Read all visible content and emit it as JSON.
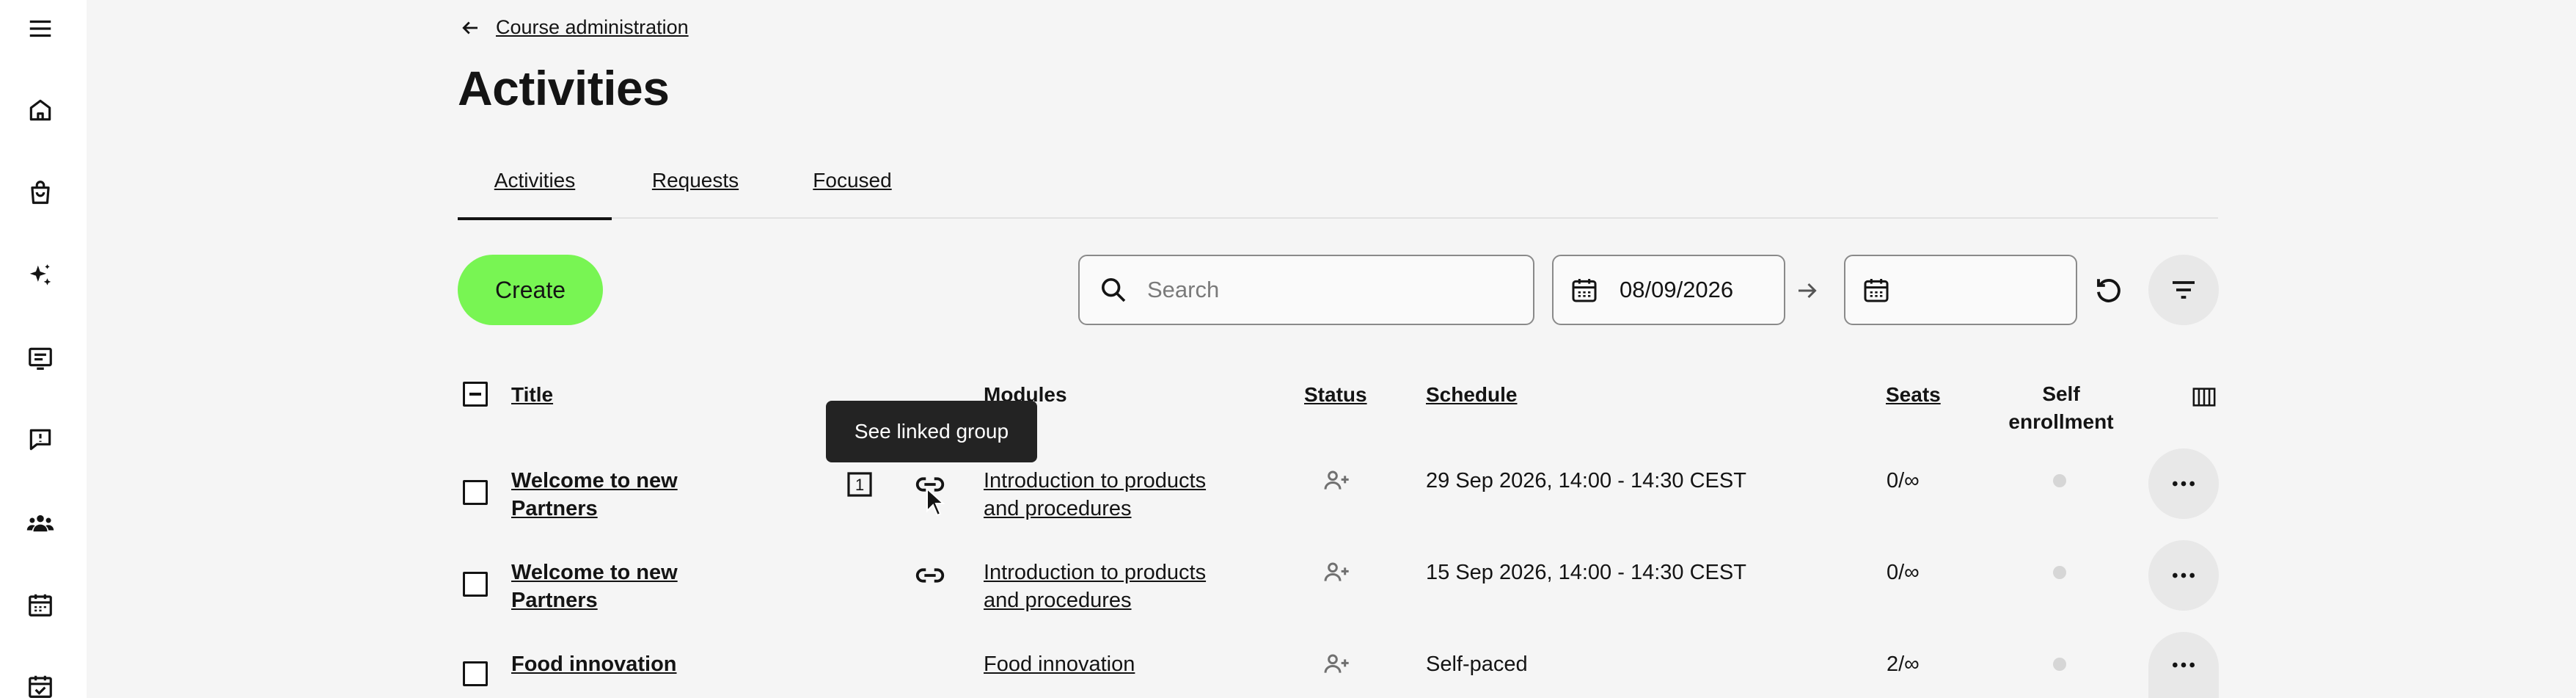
{
  "sidebar": {
    "items": [
      {
        "icon": "menu-icon"
      },
      {
        "icon": "home-icon"
      },
      {
        "icon": "shopping-bag-icon"
      },
      {
        "icon": "sparkles-icon"
      },
      {
        "icon": "document-list-icon"
      },
      {
        "icon": "feedback-icon"
      },
      {
        "icon": "users-icon"
      },
      {
        "icon": "calendar-icon"
      },
      {
        "icon": "calendar-check-icon"
      }
    ]
  },
  "header": {
    "back_label": "Course administration",
    "title": "Activities"
  },
  "tabs": [
    {
      "label": "Activities",
      "active": true
    },
    {
      "label": "Requests",
      "active": false
    },
    {
      "label": "Focused",
      "active": false
    }
  ],
  "toolbar": {
    "create_label": "Create",
    "search_placeholder": "Search",
    "date_from": "08/09/2026",
    "date_to": ""
  },
  "table": {
    "columns": {
      "title": "Title",
      "modules": "Modules",
      "status": "Status",
      "schedule": "Schedule",
      "seats": "Seats",
      "self_enrollment_line1": "Self",
      "self_enrollment_line2": "enrollment"
    },
    "rows": [
      {
        "title_line1": "Welcome to new",
        "title_line2": "Partners",
        "group_badge": "1",
        "linked": true,
        "module_line1": "Introduction to products",
        "module_line2": "and procedures",
        "schedule": "29 Sep 2026, 14:00 - 14:30 CEST",
        "seats": "0/∞"
      },
      {
        "title_line1": "Welcome to new",
        "title_line2": "Partners",
        "group_badge": "",
        "linked": true,
        "module_line1": "Introduction to products",
        "module_line2": "and procedures",
        "schedule": "15 Sep 2026, 14:00 - 14:30 CEST",
        "seats": "0/∞"
      },
      {
        "title_line1": "Food innovation",
        "title_line2": "",
        "group_badge": "",
        "linked": false,
        "module_line1": "Food innovation",
        "module_line2": "",
        "schedule": "Self-paced",
        "seats": "2/∞"
      }
    ]
  },
  "tooltip": {
    "text": "See linked group"
  },
  "colors": {
    "accent": "#78f553",
    "background": "#f5f5f5",
    "sidebar": "#ffffff",
    "text": "#141414",
    "tooltip_bg": "#232323"
  }
}
